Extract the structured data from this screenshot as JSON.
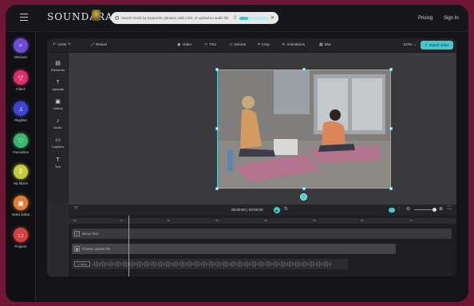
{
  "app": {
    "logo_text": "SOUNDARA"
  },
  "topbar": {
    "search_placeholder": "Search music by keywords, phrases, add a link, or upload an audio file",
    "search_upload_progress": 0.3,
    "links": [
      {
        "label": "Pricing"
      },
      {
        "label": "Sign In"
      }
    ]
  },
  "leftnav": {
    "items": [
      {
        "label": "Discover",
        "icon": "search-icon",
        "color": "#6e4bd4"
      },
      {
        "label": "Filters",
        "icon": "filter-icon",
        "color": "#d9326a"
      },
      {
        "label": "Playlists",
        "icon": "music-note-icon",
        "color": "#3e45d6"
      },
      {
        "label": "Favourites",
        "icon": "heart-icon",
        "color": "#3fb46f"
      },
      {
        "label": "My Mixes",
        "icon": "sliders-icon",
        "color": "#c9c93c"
      },
      {
        "label": "Video Editor",
        "icon": "video-icon",
        "color": "#e08036"
      },
      {
        "label": "Projects",
        "icon": "folder-icon",
        "color": "#d94040"
      }
    ]
  },
  "editor": {
    "toolbar": {
      "undo": "Undo",
      "resize": "Resize",
      "tools": [
        {
          "label": "Video",
          "icon": "video-icon"
        },
        {
          "label": "Trim",
          "icon": "scissors-icon"
        },
        {
          "label": "Volume",
          "icon": "volume-icon"
        },
        {
          "label": "Crop",
          "icon": "crop-icon"
        },
        {
          "label": "Animations",
          "icon": "animation-icon"
        },
        {
          "label": "Blur",
          "icon": "blur-icon"
        }
      ],
      "zoom": "103%",
      "export": "Export Video"
    },
    "side_tools": [
      {
        "label": "Elements",
        "icon": "elements-icon"
      },
      {
        "label": "Uploads",
        "icon": "upload-icon"
      },
      {
        "label": "Videos",
        "icon": "video-icon"
      },
      {
        "label": "Audio",
        "icon": "audio-icon"
      },
      {
        "label": "Captions",
        "icon": "captions-icon"
      },
      {
        "label": "Text",
        "icon": "text-icon"
      }
    ],
    "playback": {
      "current": "00:00:00",
      "total": "00:00:00"
    },
    "timeline": {
      "ticks": [
        "0s",
        "1s",
        "2s",
        "3s",
        "4s",
        "5s",
        "6s",
        "7s"
      ],
      "tracks": [
        {
          "label": "Demo Text",
          "type": "text"
        },
        {
          "label": "Fitness content file",
          "type": "video"
        },
        {
          "label": "Intro",
          "type": "audio"
        }
      ]
    },
    "accent_color": "#46c6cf"
  }
}
